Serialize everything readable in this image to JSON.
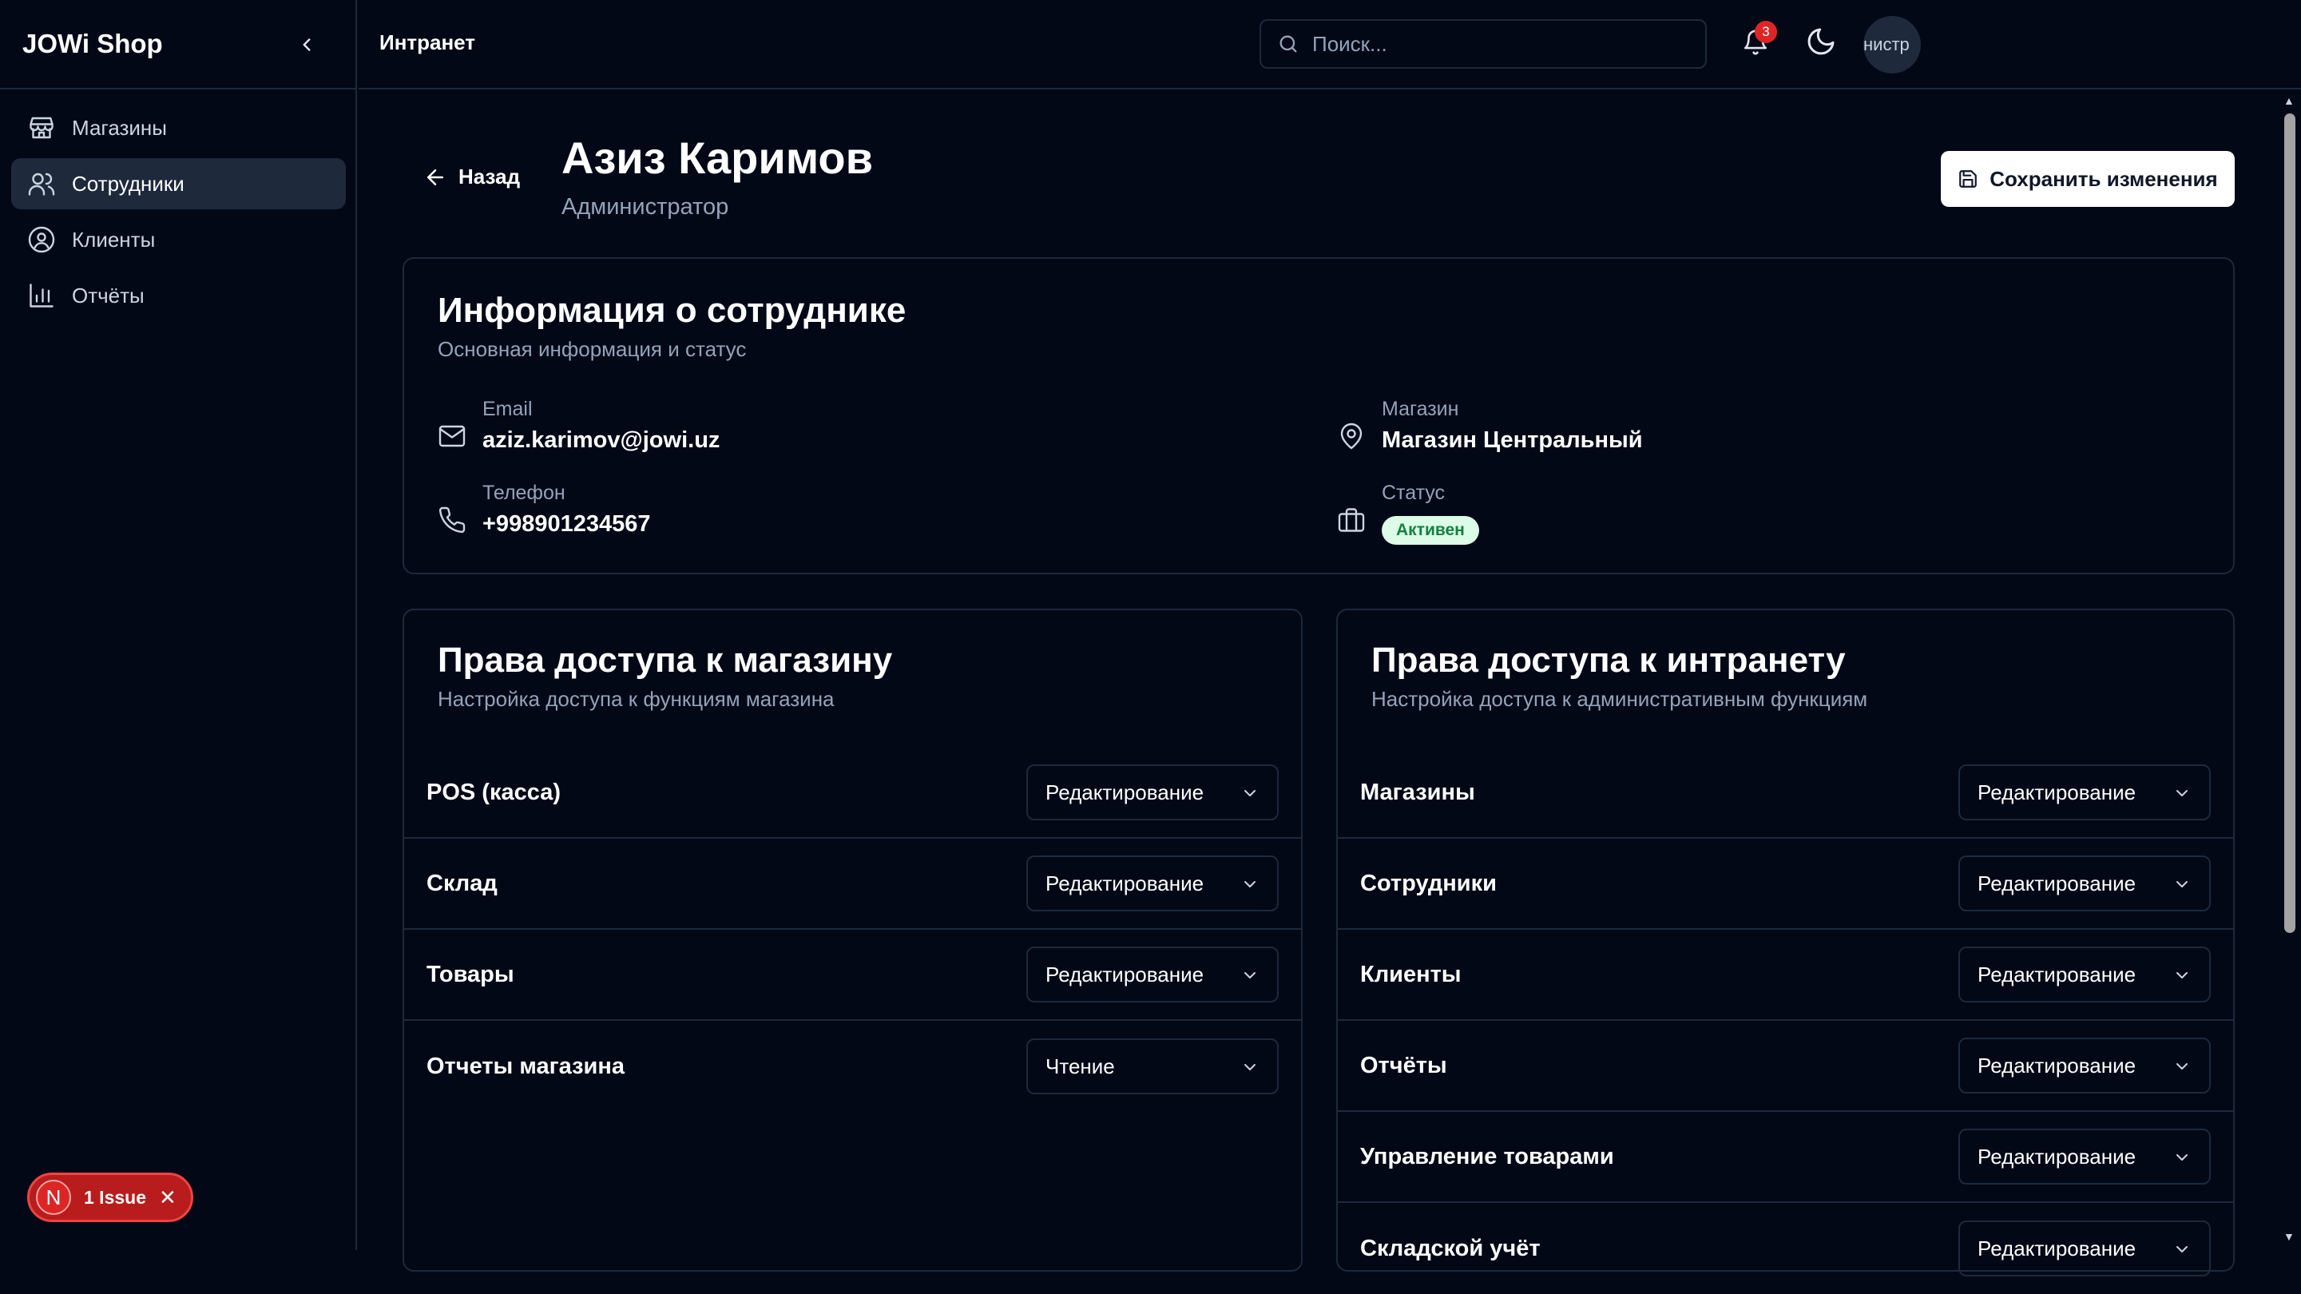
{
  "app": {
    "brand": "JOWi Shop"
  },
  "sidebar": {
    "items": [
      {
        "label": "Магазины",
        "icon": "store-icon",
        "active": false
      },
      {
        "label": "Сотрудники",
        "icon": "users-icon",
        "active": true
      },
      {
        "label": "Клиенты",
        "icon": "user-circle-icon",
        "active": false
      },
      {
        "label": "Отчёты",
        "icon": "bar-chart-icon",
        "active": false
      }
    ]
  },
  "issue": {
    "avatar_letter": "N",
    "label": "1 Issue",
    "close": "✕"
  },
  "header": {
    "breadcrumb": "Интранет",
    "search_placeholder": "Поиск...",
    "notifications_count": "3",
    "avatar_text": "нистр"
  },
  "page": {
    "back_label": "Назад",
    "title": "Азиз Каримов",
    "subtitle": "Администратор",
    "save_label": "Сохранить изменения"
  },
  "employee_info": {
    "title": "Информация о сотруднике",
    "subtitle": "Основная информация и статус",
    "email_label": "Email",
    "email_value": "aziz.karimov@jowi.uz",
    "phone_label": "Телефон",
    "phone_value": "+998901234567",
    "store_label": "Магазин",
    "store_value": "Магазин Центральный",
    "status_label": "Статус",
    "status_value": "Активен",
    "status_color": "#dcfce7"
  },
  "store_permissions": {
    "title": "Права доступа к магазину",
    "subtitle": "Настройка доступа к функциям магазина",
    "rows": [
      {
        "name": "POS (касса)",
        "value": "Редактирование"
      },
      {
        "name": "Склад",
        "value": "Редактирование"
      },
      {
        "name": "Товары",
        "value": "Редактирование"
      },
      {
        "name": "Отчеты магазина",
        "value": "Чтение"
      }
    ]
  },
  "intranet_permissions": {
    "title": "Права доступа к интранету",
    "subtitle": "Настройка доступа к административным функциям",
    "rows": [
      {
        "name": "Магазины",
        "value": "Редактирование"
      },
      {
        "name": "Сотрудники",
        "value": "Редактирование"
      },
      {
        "name": "Клиенты",
        "value": "Редактирование"
      },
      {
        "name": "Отчёты",
        "value": "Редактирование"
      },
      {
        "name": "Управление товарами",
        "value": "Редактирование"
      },
      {
        "name": "Складской учёт",
        "value": "Редактирование"
      }
    ]
  }
}
